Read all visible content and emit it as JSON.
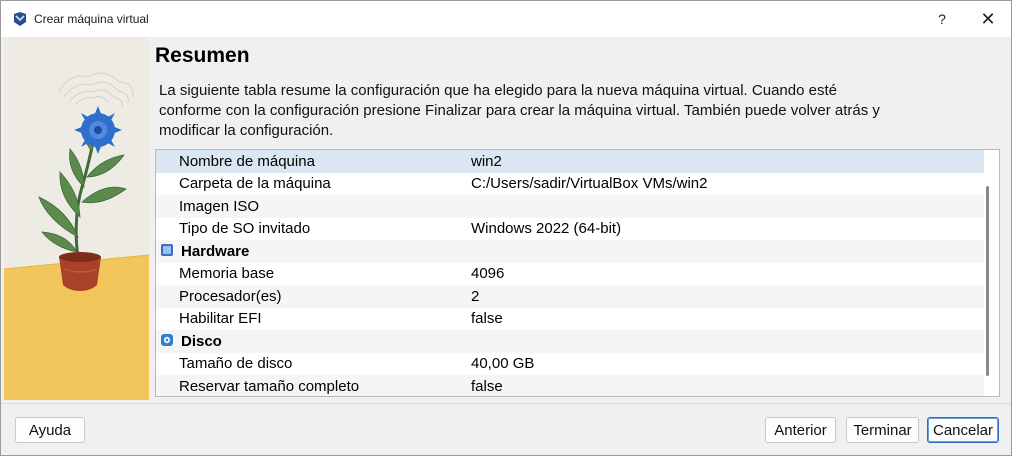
{
  "window": {
    "title": "Crear máquina virtual",
    "help_label": "?",
    "close_label": "✕"
  },
  "page": {
    "heading": "Resumen",
    "description": "La siguiente tabla resume la configuración que ha elegido para la nueva máquina virtual. Cuando esté conforme con la configuración presione Finalizar para crear la máquina virtual. También puede volver atrás y modificar la configuración."
  },
  "summary": {
    "rows": [
      {
        "label": "Nombre de máquina",
        "value": "win2"
      },
      {
        "label": "Carpeta de la máquina",
        "value": "C:/Users/sadir/VirtualBox VMs/win2"
      },
      {
        "label": "Imagen ISO",
        "value": ""
      },
      {
        "label": "Tipo de SO invitado",
        "value": "Windows 2022 (64-bit)"
      }
    ],
    "hardware_title": "Hardware",
    "hardware_icon": "chip-icon",
    "hardware_rows": [
      {
        "label": "Memoria base",
        "value": "4096"
      },
      {
        "label": "Procesador(es)",
        "value": "2"
      },
      {
        "label": "Habilitar EFI",
        "value": "false"
      }
    ],
    "disk_title": "Disco",
    "disk_icon": "disk-icon",
    "disk_rows": [
      {
        "label": "Tamaño de disco",
        "value": "40,00 GB"
      },
      {
        "label": "Reservar tamaño completo",
        "value": "false"
      }
    ]
  },
  "buttons": {
    "help": "Ayuda",
    "back": "Anterior",
    "finish": "Terminar",
    "cancel": "Cancelar"
  },
  "colors": {
    "selected_row": "#dbe6f3",
    "accent": "#2d6fc7",
    "flower": "#2f6fc9",
    "pot": "#a8432a",
    "table_floor": "#f2c65a"
  }
}
